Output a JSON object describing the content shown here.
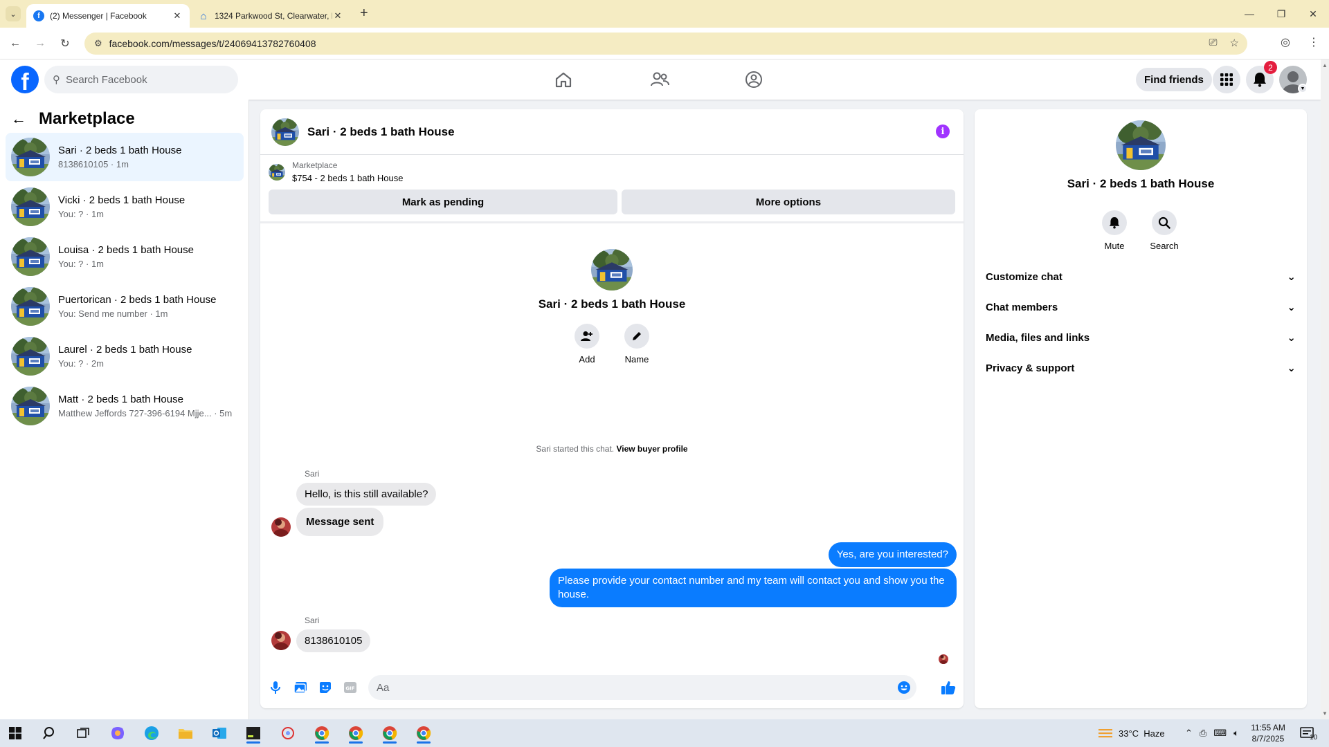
{
  "colors": {
    "fb_blue": "#0866ff",
    "bubble_out": "#0a7cff",
    "bubble_in": "#e9e9eb",
    "badge_red": "#e41e3f",
    "info_purple": "#a033ff"
  },
  "browser": {
    "tabs": [
      {
        "title": "(2) Messenger | Facebook",
        "icon": "facebook-icon"
      },
      {
        "title": "1324 Parkwood St, Clearwater, F",
        "icon": "zillow-icon"
      }
    ],
    "url": "facebook.com/messages/t/24069413782760408"
  },
  "header": {
    "search_placeholder": "Search Facebook",
    "find_friends": "Find friends",
    "notification_count": "2"
  },
  "left_panel": {
    "title": "Marketplace",
    "conversations": [
      {
        "name": "Sari · 2 beds 1 bath House",
        "sub": "8138610105 · 1m"
      },
      {
        "name": "Vicki · 2 beds 1 bath House",
        "sub": "You: ? · 1m"
      },
      {
        "name": "Louisa · 2 beds 1 bath House",
        "sub": "You: ? · 1m"
      },
      {
        "name": "Puertorican · 2 beds 1 bath House",
        "sub": "You: Send me number · 1m"
      },
      {
        "name": "Laurel · 2 beds 1 bath House",
        "sub": "You: ? · 2m"
      },
      {
        "name": "Matt · 2 beds 1 bath House",
        "sub": "Matthew Jeffords 727-396-6194 Mjje... · 5m"
      }
    ]
  },
  "conversation": {
    "title": "Sari · 2 beds 1 bath House",
    "banner_label": "Marketplace",
    "banner_listing": "$754 - 2 beds 1 bath House",
    "mark_pending": "Mark as pending",
    "more_options": "More options",
    "intro_name": "Sari · 2 beds 1 bath House",
    "action_add": "Add",
    "action_name": "Name",
    "started_text": "Sari started this chat. ",
    "view_profile": "View buyer profile",
    "messages": {
      "sender1": "Sari",
      "in1": "Hello, is this still available?",
      "in2": "Message sent",
      "out1": "Yes, are you interested?",
      "out2": "Please provide your contact number and my team will contact you and show you the house.",
      "sender2": "Sari",
      "in3": "8138610105"
    },
    "composer_placeholder": "Aa"
  },
  "details": {
    "name": "Sari · 2 beds 1 bath House",
    "mute": "Mute",
    "search": "Search",
    "sections": [
      "Customize chat",
      "Chat members",
      "Media, files and links",
      "Privacy & support"
    ]
  },
  "taskbar": {
    "weather": "33°C  Haze",
    "time": "11:55 AM",
    "date": "8/7/2025",
    "notification_count": "10"
  }
}
